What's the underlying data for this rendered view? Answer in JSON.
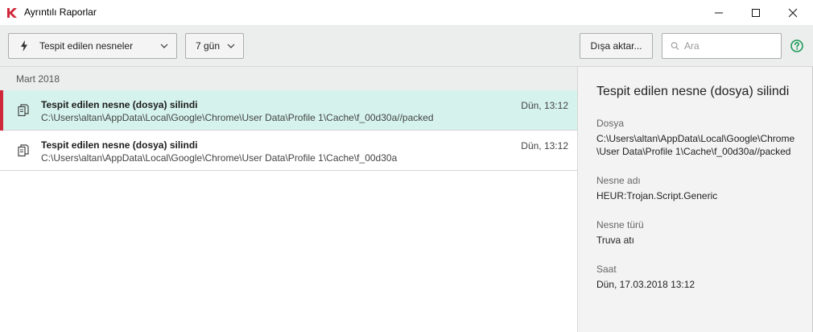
{
  "window": {
    "title": "Ayrıntılı Raporlar",
    "controls": {
      "minimize": "—",
      "maximize": "☐",
      "close": "✕"
    }
  },
  "toolbar": {
    "filter_label": "Tespit edilen nesneler",
    "period_label": "7 gün",
    "export_label": "Dışa aktar...",
    "search_placeholder": "Ara",
    "search_value": ""
  },
  "list": {
    "group_header": "Mart 2018",
    "rows": [
      {
        "title": "Tespit edilen nesne (dosya) silindi",
        "path": "C:\\Users\\altan\\AppData\\Local\\Google\\Chrome\\User Data\\Profile 1\\Cache\\f_00d30a//packed",
        "time": "Dün, 13:12",
        "selected": true
      },
      {
        "title": "Tespit edilen nesne (dosya) silindi",
        "path": "C:\\Users\\altan\\AppData\\Local\\Google\\Chrome\\User Data\\Profile 1\\Cache\\f_00d30a",
        "time": "Dün, 13:12",
        "selected": false
      }
    ]
  },
  "details": {
    "title": "Tespit edilen nesne (dosya) silindi",
    "file_label": "Dosya",
    "file_value": "C:\\Users\\altan\\AppData\\Local\\Google\\Chrome\\User Data\\Profile 1\\Cache\\f_00d30a//packed",
    "name_label": "Nesne adı",
    "name_value": "HEUR:Trojan.Script.Generic",
    "type_label": "Nesne türü",
    "type_value": "Truva atı",
    "time_label": "Saat",
    "time_value": "Dün, 17.03.2018 13:12"
  },
  "colors": {
    "accent_selected_bar": "#d0283b",
    "selected_row_bg": "#d5f3ec",
    "help_green": "#1d9b57",
    "brand_red": "#d0283b"
  }
}
